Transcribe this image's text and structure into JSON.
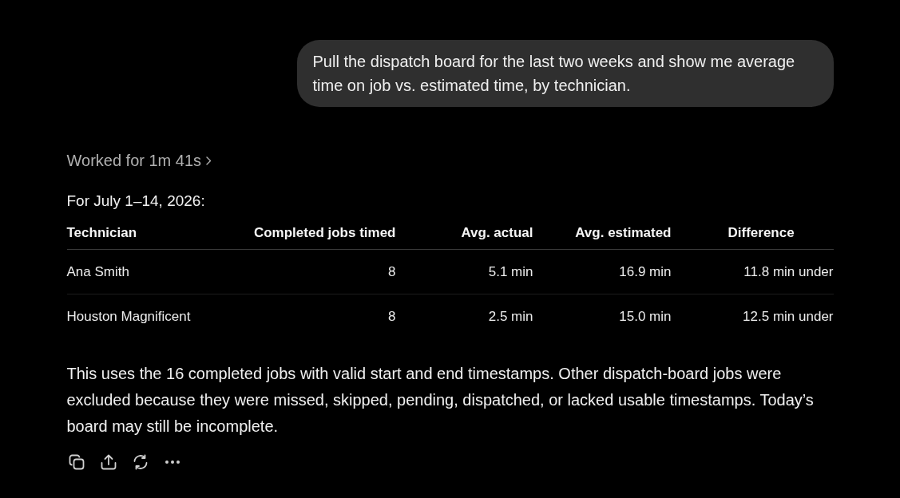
{
  "user_message": {
    "text": "Pull the dispatch board for the last two weeks and show me average time on job vs. estimated time, by technician."
  },
  "response": {
    "worked_for": {
      "label": "Worked for 1m 41s",
      "expanded": false
    },
    "intro": "For July 1–14, 2026:",
    "table": {
      "columns": [
        "Technician",
        "Completed jobs timed",
        "Avg. actual",
        "Avg. estimated",
        "Difference"
      ],
      "rows": [
        [
          "Ana Smith",
          "8",
          "5.1 min",
          "16.9 min",
          "11.8 min under"
        ],
        [
          "Houston Magnificent",
          "8",
          "2.5 min",
          "15.0 min",
          "12.5 min under"
        ]
      ]
    },
    "note": "This uses the 16 completed jobs with valid start and end timestamps. Other dispatch-board jobs were excluded because they were missed, skipped, pending, dispatched, or lacked usable timestamps. Today’s board may still be incomplete."
  }
}
